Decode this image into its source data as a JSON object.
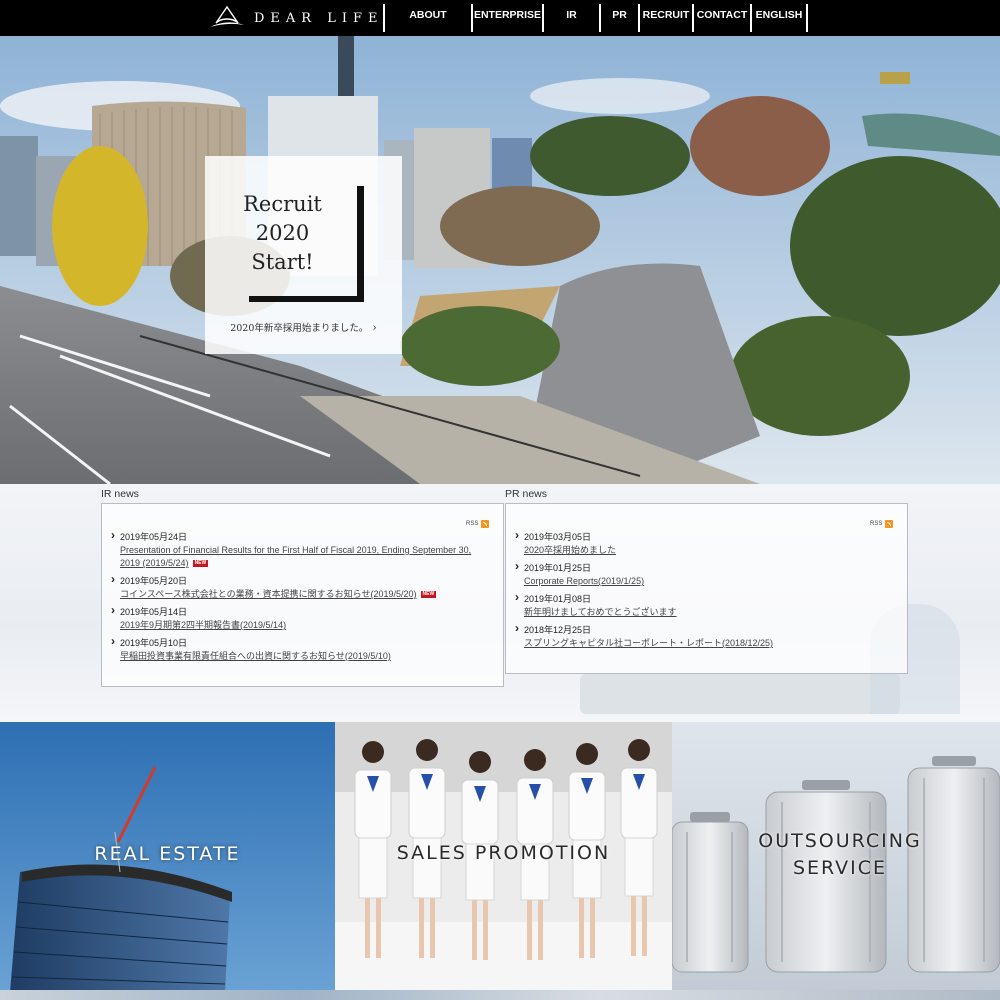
{
  "header": {
    "logo_text": "DEAR LIFE",
    "nav": [
      {
        "label": "ABOUT"
      },
      {
        "label": "ENTERPRISE"
      },
      {
        "label": "IR"
      },
      {
        "label": "PR"
      },
      {
        "label": "RECRUIT"
      },
      {
        "label": "CONTACT"
      },
      {
        "label": "ENGLISH"
      }
    ]
  },
  "hero": {
    "recruit_title": "Recruit\n2020\nStart!",
    "recruit_sub": "2020年新卒採用始まりました。"
  },
  "ir_news": {
    "label": "IR news",
    "rss": "RSS",
    "new_badge": "NEW",
    "items": [
      {
        "date": "2019年05月24日",
        "title": "Presentation of Financial Results for the First Half of Fiscal 2019, Ending September 30, 2019 (2019/5/24)",
        "is_new": true
      },
      {
        "date": "2019年05月20日",
        "title": "コインスペース株式会社との業務・資本提携に関するお知らせ(2019/5/20)",
        "is_new": true
      },
      {
        "date": "2019年05月14日",
        "title": "2019年9月期第2四半期報告書(2019/5/14)",
        "is_new": false
      },
      {
        "date": "2019年05月10日",
        "title": "早稲田投資事業有限責任組合への出資に関するお知らせ(2019/5/10)",
        "is_new": false
      }
    ]
  },
  "pr_news": {
    "label": "PR news",
    "rss": "RSS",
    "items": [
      {
        "date": "2019年03月05日",
        "title": "2020卒採用始めました"
      },
      {
        "date": "2019年01月25日",
        "title": "Corporate Reports(2019/1/25)"
      },
      {
        "date": "2019年01月08日",
        "title": "新年明けましておめでとうございます"
      },
      {
        "date": "2018年12月25日",
        "title": "スプリングキャピタル社コーポレート・レポート(2018/12/25)"
      }
    ]
  },
  "tiles": [
    {
      "label": "REAL ESTATE"
    },
    {
      "label": "SALES PROMOTION"
    },
    {
      "label": "OUTSOURCING\nSERVICE"
    }
  ],
  "colors": {
    "header_bg": "#000000",
    "new_badge": "#c8161d",
    "rss": "#f7931e"
  }
}
